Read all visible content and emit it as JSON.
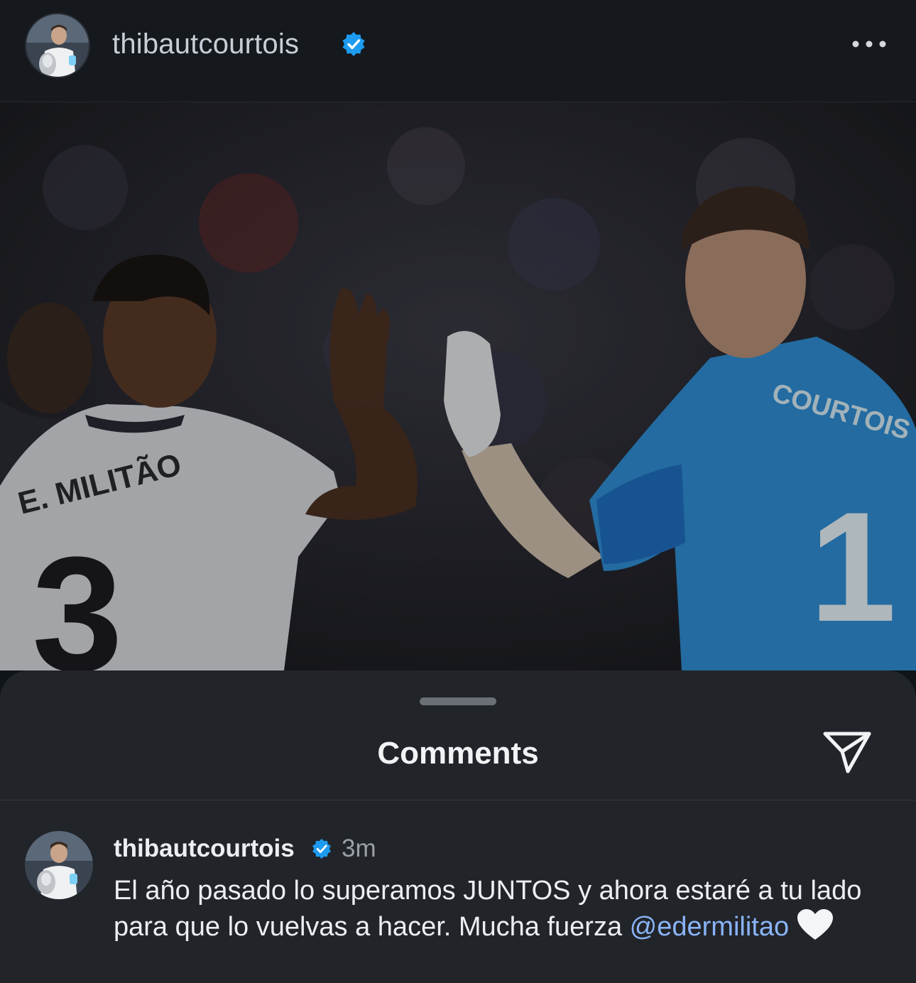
{
  "post": {
    "username": "thibautcourtois",
    "more_icon": "more-horizontal-icon",
    "photo_jerseys": {
      "left_name": "E. MILITÃO",
      "left_number": "3",
      "right_name": "COURTOIS",
      "right_number": "1"
    }
  },
  "sheet": {
    "title": "Comments",
    "share_icon": "paper-plane-icon"
  },
  "comment": {
    "username": "thibautcourtois",
    "time": "3m",
    "text": "El año pasado lo superamos JUNTOS y ahora estaré a tu lado para que lo vuelvas a hacer. Mucha fuerza ",
    "mention": "@edermilitao",
    "emoji": "white-heart-icon"
  },
  "colors": {
    "verified": "#1d9bf0",
    "mention": "#8ab4f8",
    "sheet_bg": "#212429",
    "header_bg": "#15181d"
  }
}
